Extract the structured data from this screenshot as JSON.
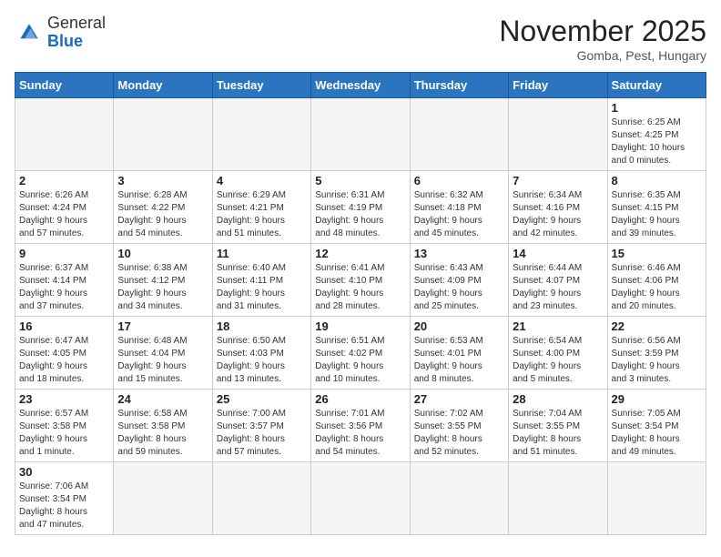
{
  "header": {
    "logo_general": "General",
    "logo_blue": "Blue",
    "month_title": "November 2025",
    "subtitle": "Gomba, Pest, Hungary"
  },
  "weekdays": [
    "Sunday",
    "Monday",
    "Tuesday",
    "Wednesday",
    "Thursday",
    "Friday",
    "Saturday"
  ],
  "weeks": [
    [
      {
        "day": "",
        "info": ""
      },
      {
        "day": "",
        "info": ""
      },
      {
        "day": "",
        "info": ""
      },
      {
        "day": "",
        "info": ""
      },
      {
        "day": "",
        "info": ""
      },
      {
        "day": "",
        "info": ""
      },
      {
        "day": "1",
        "info": "Sunrise: 6:25 AM\nSunset: 4:25 PM\nDaylight: 10 hours\nand 0 minutes."
      }
    ],
    [
      {
        "day": "2",
        "info": "Sunrise: 6:26 AM\nSunset: 4:24 PM\nDaylight: 9 hours\nand 57 minutes."
      },
      {
        "day": "3",
        "info": "Sunrise: 6:28 AM\nSunset: 4:22 PM\nDaylight: 9 hours\nand 54 minutes."
      },
      {
        "day": "4",
        "info": "Sunrise: 6:29 AM\nSunset: 4:21 PM\nDaylight: 9 hours\nand 51 minutes."
      },
      {
        "day": "5",
        "info": "Sunrise: 6:31 AM\nSunset: 4:19 PM\nDaylight: 9 hours\nand 48 minutes."
      },
      {
        "day": "6",
        "info": "Sunrise: 6:32 AM\nSunset: 4:18 PM\nDaylight: 9 hours\nand 45 minutes."
      },
      {
        "day": "7",
        "info": "Sunrise: 6:34 AM\nSunset: 4:16 PM\nDaylight: 9 hours\nand 42 minutes."
      },
      {
        "day": "8",
        "info": "Sunrise: 6:35 AM\nSunset: 4:15 PM\nDaylight: 9 hours\nand 39 minutes."
      }
    ],
    [
      {
        "day": "9",
        "info": "Sunrise: 6:37 AM\nSunset: 4:14 PM\nDaylight: 9 hours\nand 37 minutes."
      },
      {
        "day": "10",
        "info": "Sunrise: 6:38 AM\nSunset: 4:12 PM\nDaylight: 9 hours\nand 34 minutes."
      },
      {
        "day": "11",
        "info": "Sunrise: 6:40 AM\nSunset: 4:11 PM\nDaylight: 9 hours\nand 31 minutes."
      },
      {
        "day": "12",
        "info": "Sunrise: 6:41 AM\nSunset: 4:10 PM\nDaylight: 9 hours\nand 28 minutes."
      },
      {
        "day": "13",
        "info": "Sunrise: 6:43 AM\nSunset: 4:09 PM\nDaylight: 9 hours\nand 25 minutes."
      },
      {
        "day": "14",
        "info": "Sunrise: 6:44 AM\nSunset: 4:07 PM\nDaylight: 9 hours\nand 23 minutes."
      },
      {
        "day": "15",
        "info": "Sunrise: 6:46 AM\nSunset: 4:06 PM\nDaylight: 9 hours\nand 20 minutes."
      }
    ],
    [
      {
        "day": "16",
        "info": "Sunrise: 6:47 AM\nSunset: 4:05 PM\nDaylight: 9 hours\nand 18 minutes."
      },
      {
        "day": "17",
        "info": "Sunrise: 6:48 AM\nSunset: 4:04 PM\nDaylight: 9 hours\nand 15 minutes."
      },
      {
        "day": "18",
        "info": "Sunrise: 6:50 AM\nSunset: 4:03 PM\nDaylight: 9 hours\nand 13 minutes."
      },
      {
        "day": "19",
        "info": "Sunrise: 6:51 AM\nSunset: 4:02 PM\nDaylight: 9 hours\nand 10 minutes."
      },
      {
        "day": "20",
        "info": "Sunrise: 6:53 AM\nSunset: 4:01 PM\nDaylight: 9 hours\nand 8 minutes."
      },
      {
        "day": "21",
        "info": "Sunrise: 6:54 AM\nSunset: 4:00 PM\nDaylight: 9 hours\nand 5 minutes."
      },
      {
        "day": "22",
        "info": "Sunrise: 6:56 AM\nSunset: 3:59 PM\nDaylight: 9 hours\nand 3 minutes."
      }
    ],
    [
      {
        "day": "23",
        "info": "Sunrise: 6:57 AM\nSunset: 3:58 PM\nDaylight: 9 hours\nand 1 minute."
      },
      {
        "day": "24",
        "info": "Sunrise: 6:58 AM\nSunset: 3:58 PM\nDaylight: 8 hours\nand 59 minutes."
      },
      {
        "day": "25",
        "info": "Sunrise: 7:00 AM\nSunset: 3:57 PM\nDaylight: 8 hours\nand 57 minutes."
      },
      {
        "day": "26",
        "info": "Sunrise: 7:01 AM\nSunset: 3:56 PM\nDaylight: 8 hours\nand 54 minutes."
      },
      {
        "day": "27",
        "info": "Sunrise: 7:02 AM\nSunset: 3:55 PM\nDaylight: 8 hours\nand 52 minutes."
      },
      {
        "day": "28",
        "info": "Sunrise: 7:04 AM\nSunset: 3:55 PM\nDaylight: 8 hours\nand 51 minutes."
      },
      {
        "day": "29",
        "info": "Sunrise: 7:05 AM\nSunset: 3:54 PM\nDaylight: 8 hours\nand 49 minutes."
      }
    ],
    [
      {
        "day": "30",
        "info": "Sunrise: 7:06 AM\nSunset: 3:54 PM\nDaylight: 8 hours\nand 47 minutes."
      },
      {
        "day": "",
        "info": ""
      },
      {
        "day": "",
        "info": ""
      },
      {
        "day": "",
        "info": ""
      },
      {
        "day": "",
        "info": ""
      },
      {
        "day": "",
        "info": ""
      },
      {
        "day": "",
        "info": ""
      }
    ]
  ]
}
